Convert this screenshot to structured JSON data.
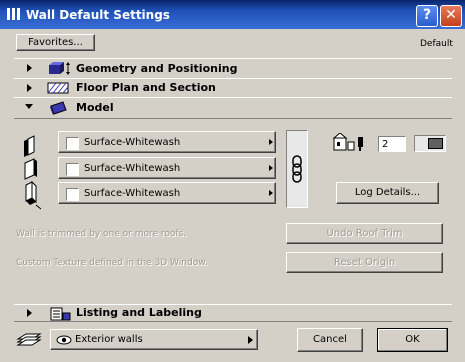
{
  "window": {
    "title": "Wall Default Settings",
    "help_label": "?",
    "close_label": "✕"
  },
  "favorites": {
    "label": "Favorites...",
    "default_label": "Default"
  },
  "sections": [
    {
      "label": "Geometry and Positioning",
      "expanded": false,
      "icon": "cube-icon"
    },
    {
      "label": "Floor Plan and Section",
      "expanded": false,
      "icon": "hatch-icon"
    },
    {
      "label": "Model",
      "expanded": true,
      "icon": "wall-shape-icon"
    }
  ],
  "model": {
    "surfaces": [
      {
        "label": "Surface-Whitewash",
        "icon": "wall-left-surface-icon"
      },
      {
        "label": "Surface-Whitewash",
        "icon": "wall-edge-surface-icon"
      },
      {
        "label": "Surface-Whitewash",
        "icon": "wall-right-surface-icon"
      }
    ],
    "link_icon": "chain-link-icon",
    "log_count": "2",
    "log_details_label": "Log Details...",
    "trim_message": "Wall is trimmed by one or more roofs.",
    "undo_roof_trim_label": "Undo Roof Trim",
    "texture_message": "Custom Texture defined in the 3D Window.",
    "reset_origin_label": "Reset Origin"
  },
  "listing": {
    "label": "Listing and Labeling",
    "icon": "list-icon"
  },
  "footer": {
    "layer_value": "Exterior walls",
    "cancel_label": "Cancel",
    "ok_label": "OK"
  },
  "colors": {
    "titlebar": "#0a246a",
    "face": "#d4d0c8"
  }
}
